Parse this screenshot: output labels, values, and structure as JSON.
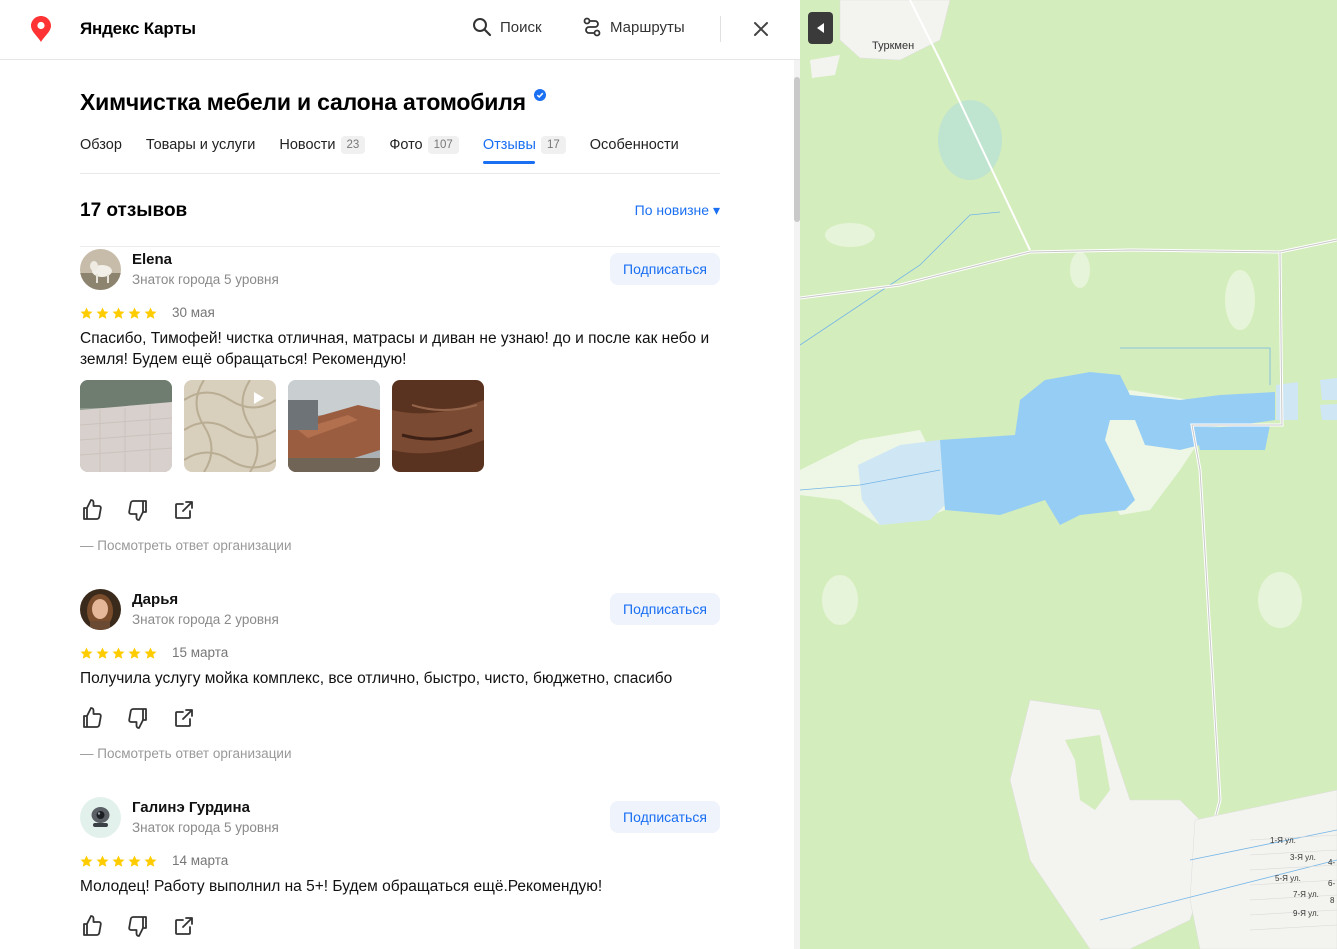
{
  "header": {
    "brand": "Яндекс Карты",
    "search_label": "Поиск",
    "routes_label": "Маршруты",
    "accent_color": "#1a6ff2",
    "logo_color": "#f33"
  },
  "organization": {
    "title": "Химчистка мебели и салона атомобиля",
    "verified": true
  },
  "tabs": [
    {
      "label": "Обзор",
      "count": ""
    },
    {
      "label": "Товары и услуги",
      "count": ""
    },
    {
      "label": "Новости",
      "count": "23"
    },
    {
      "label": "Фото",
      "count": "107"
    },
    {
      "label": "Отзывы",
      "count": "17",
      "active": true
    },
    {
      "label": "Особенности",
      "count": ""
    }
  ],
  "reviews_header": {
    "count_label": "17 отзывов",
    "sort_label": "По новизне ▾"
  },
  "reviews": [
    {
      "author": "Elena",
      "level": "Знаток города 5 уровня",
      "subscribe": "Подписаться",
      "rating": 5,
      "date": "30 мая",
      "text": "Спасибо, Тимофей! чистка отличная, матрасы и диван не узнаю! до и после как небо и земля! Будем ещё обращаться! Рекомендую!",
      "photos": [
        "mattress-photo",
        "mattress-video",
        "sofa-photo",
        "leather-photo"
      ],
      "org_reply": "Посмотреть ответ организации"
    },
    {
      "author": "Дарья",
      "level": "Знаток города 2 уровня",
      "subscribe": "Подписаться",
      "rating": 5,
      "date": "15 марта",
      "text": "Получила услугу мойка комплекс, все отлично, быстро, чисто, бюджетно, спасибо",
      "org_reply": "Посмотреть ответ организации"
    },
    {
      "author": "Галинэ Гурдина",
      "level": "Знаток города 5 уровня",
      "subscribe": "Подписаться",
      "rating": 5,
      "date": "14 марта",
      "text": "Молодец! Работу выполнил на 5+! Будем обращаться ещё.Рекомендую!"
    }
  ],
  "map": {
    "village_label": "Туркмен",
    "streets": [
      "1-Я ул.",
      "3-Я ул.",
      "4-",
      "5-Я ул.",
      "6-",
      "7-Я ул.",
      "8",
      "9-Я ул."
    ],
    "forest_color": "#d4edbc",
    "water_color": "#96cdf5"
  }
}
